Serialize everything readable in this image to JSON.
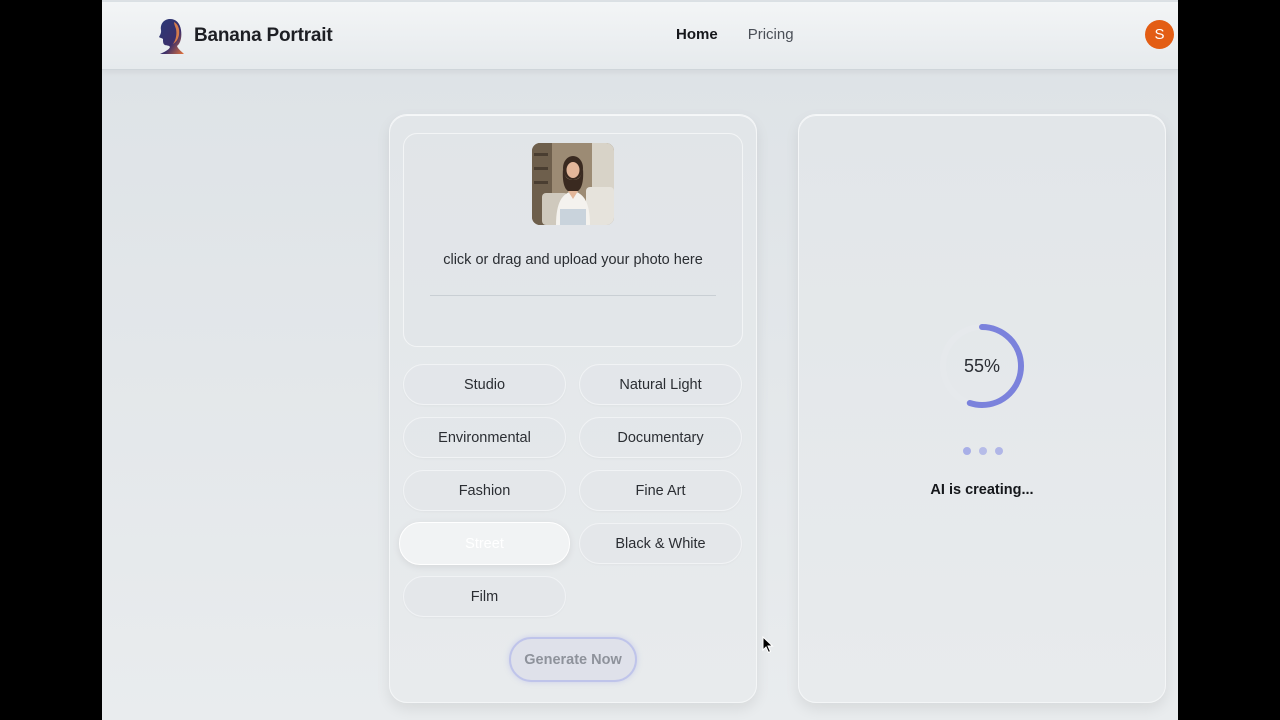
{
  "brand": {
    "name": "Banana Portrait"
  },
  "nav": {
    "items": [
      {
        "label": "Home",
        "active": true
      },
      {
        "label": "Pricing",
        "active": false
      }
    ]
  },
  "user": {
    "avatar_initial": "S",
    "avatar_color": "#e35d14"
  },
  "upload": {
    "instruction": "click or drag and upload your photo here"
  },
  "styles": [
    {
      "label": "Studio",
      "selected": false
    },
    {
      "label": "Natural Light",
      "selected": false
    },
    {
      "label": "Environmental",
      "selected": false
    },
    {
      "label": "Documentary",
      "selected": false
    },
    {
      "label": "Fashion",
      "selected": false
    },
    {
      "label": "Fine Art",
      "selected": false
    },
    {
      "label": "Street",
      "selected": true
    },
    {
      "label": "Black & White",
      "selected": false
    },
    {
      "label": "Film",
      "selected": false
    }
  ],
  "generate": {
    "label": "Generate Now"
  },
  "progress": {
    "percent_label": "55%",
    "value": 0.55,
    "status": "AI is creating...",
    "accent": "#7b82dc"
  }
}
